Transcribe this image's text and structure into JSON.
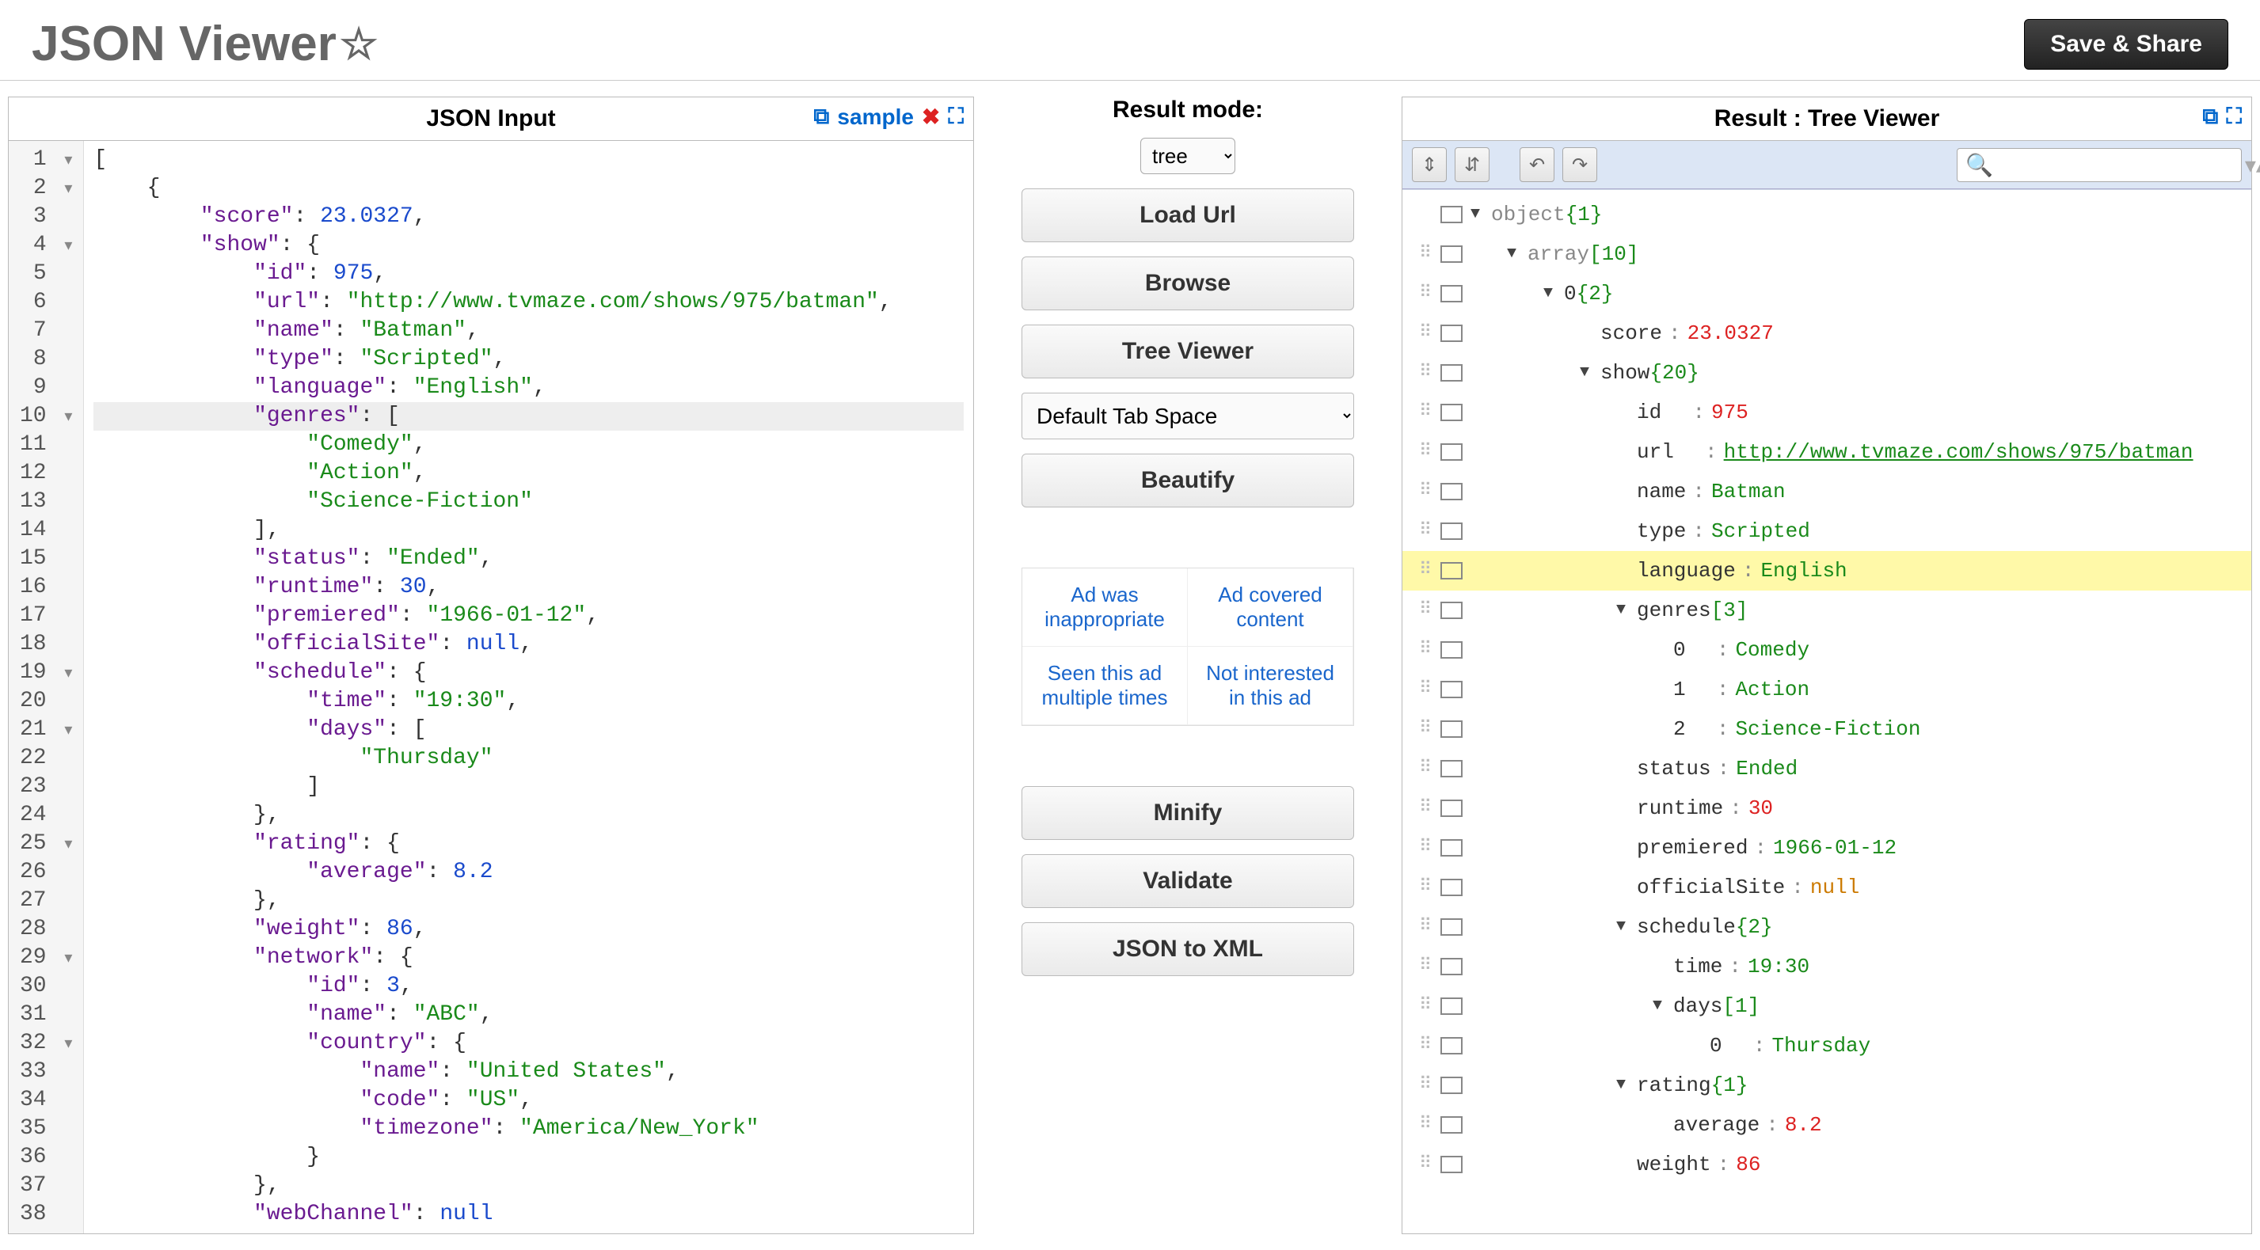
{
  "header": {
    "title": "JSON Viewer",
    "save_label": "Save & Share"
  },
  "left_panel": {
    "title": "JSON Input",
    "sample_label": "sample",
    "lines": [
      {
        "n": 1,
        "fold": "▾",
        "text": "[",
        "hl": false,
        "tokens": [
          [
            "[",
            "punc"
          ]
        ]
      },
      {
        "n": 2,
        "fold": "▾",
        "text": "    {",
        "hl": false,
        "tokens": [
          [
            "    {",
            "punc"
          ]
        ]
      },
      {
        "n": 3,
        "fold": "",
        "hl": false,
        "tokens": [
          [
            "        ",
            "punc"
          ],
          [
            "\"score\"",
            "key"
          ],
          [
            ": ",
            "punc"
          ],
          [
            "23.0327",
            "num"
          ],
          [
            ",",
            "punc"
          ]
        ]
      },
      {
        "n": 4,
        "fold": "▾",
        "hl": false,
        "tokens": [
          [
            "        ",
            "punc"
          ],
          [
            "\"show\"",
            "key"
          ],
          [
            ": {",
            "punc"
          ]
        ]
      },
      {
        "n": 5,
        "fold": "",
        "hl": false,
        "tokens": [
          [
            "            ",
            "punc"
          ],
          [
            "\"id\"",
            "key"
          ],
          [
            ": ",
            "punc"
          ],
          [
            "975",
            "num"
          ],
          [
            ",",
            "punc"
          ]
        ]
      },
      {
        "n": 6,
        "fold": "",
        "hl": false,
        "tokens": [
          [
            "            ",
            "punc"
          ],
          [
            "\"url\"",
            "key"
          ],
          [
            ": ",
            "punc"
          ],
          [
            "\"http://www.tvmaze.com/shows/975/batman\"",
            "str"
          ],
          [
            ",",
            "punc"
          ]
        ]
      },
      {
        "n": 7,
        "fold": "",
        "hl": false,
        "tokens": [
          [
            "            ",
            "punc"
          ],
          [
            "\"name\"",
            "key"
          ],
          [
            ": ",
            "punc"
          ],
          [
            "\"Batman\"",
            "str"
          ],
          [
            ",",
            "punc"
          ]
        ]
      },
      {
        "n": 8,
        "fold": "",
        "hl": false,
        "tokens": [
          [
            "            ",
            "punc"
          ],
          [
            "\"type\"",
            "key"
          ],
          [
            ": ",
            "punc"
          ],
          [
            "\"Scripted\"",
            "str"
          ],
          [
            ",",
            "punc"
          ]
        ]
      },
      {
        "n": 9,
        "fold": "",
        "hl": false,
        "tokens": [
          [
            "            ",
            "punc"
          ],
          [
            "\"language\"",
            "key"
          ],
          [
            ": ",
            "punc"
          ],
          [
            "\"English\"",
            "str"
          ],
          [
            ",",
            "punc"
          ]
        ]
      },
      {
        "n": 10,
        "fold": "▾",
        "hl": true,
        "tokens": [
          [
            "            ",
            "punc"
          ],
          [
            "\"genres\"",
            "key"
          ],
          [
            ": [",
            "punc"
          ]
        ]
      },
      {
        "n": 11,
        "fold": "",
        "hl": false,
        "tokens": [
          [
            "                ",
            "punc"
          ],
          [
            "\"Comedy\"",
            "str"
          ],
          [
            ",",
            "punc"
          ]
        ]
      },
      {
        "n": 12,
        "fold": "",
        "hl": false,
        "tokens": [
          [
            "                ",
            "punc"
          ],
          [
            "\"Action\"",
            "str"
          ],
          [
            ",",
            "punc"
          ]
        ]
      },
      {
        "n": 13,
        "fold": "",
        "hl": false,
        "tokens": [
          [
            "                ",
            "punc"
          ],
          [
            "\"Science-Fiction\"",
            "str"
          ]
        ]
      },
      {
        "n": 14,
        "fold": "",
        "hl": false,
        "tokens": [
          [
            "            ],",
            "punc"
          ]
        ]
      },
      {
        "n": 15,
        "fold": "",
        "hl": false,
        "tokens": [
          [
            "            ",
            "punc"
          ],
          [
            "\"status\"",
            "key"
          ],
          [
            ": ",
            "punc"
          ],
          [
            "\"Ended\"",
            "str"
          ],
          [
            ",",
            "punc"
          ]
        ]
      },
      {
        "n": 16,
        "fold": "",
        "hl": false,
        "tokens": [
          [
            "            ",
            "punc"
          ],
          [
            "\"runtime\"",
            "key"
          ],
          [
            ": ",
            "punc"
          ],
          [
            "30",
            "num"
          ],
          [
            ",",
            "punc"
          ]
        ]
      },
      {
        "n": 17,
        "fold": "",
        "hl": false,
        "tokens": [
          [
            "            ",
            "punc"
          ],
          [
            "\"premiered\"",
            "key"
          ],
          [
            ": ",
            "punc"
          ],
          [
            "\"1966-01-12\"",
            "str"
          ],
          [
            ",",
            "punc"
          ]
        ]
      },
      {
        "n": 18,
        "fold": "",
        "hl": false,
        "tokens": [
          [
            "            ",
            "punc"
          ],
          [
            "\"officialSite\"",
            "key"
          ],
          [
            ": ",
            "punc"
          ],
          [
            "null",
            "null"
          ],
          [
            ",",
            "punc"
          ]
        ]
      },
      {
        "n": 19,
        "fold": "▾",
        "hl": false,
        "tokens": [
          [
            "            ",
            "punc"
          ],
          [
            "\"schedule\"",
            "key"
          ],
          [
            ": {",
            "punc"
          ]
        ]
      },
      {
        "n": 20,
        "fold": "",
        "hl": false,
        "tokens": [
          [
            "                ",
            "punc"
          ],
          [
            "\"time\"",
            "key"
          ],
          [
            ": ",
            "punc"
          ],
          [
            "\"19:30\"",
            "str"
          ],
          [
            ",",
            "punc"
          ]
        ]
      },
      {
        "n": 21,
        "fold": "▾",
        "hl": false,
        "tokens": [
          [
            "                ",
            "punc"
          ],
          [
            "\"days\"",
            "key"
          ],
          [
            ": [",
            "punc"
          ]
        ]
      },
      {
        "n": 22,
        "fold": "",
        "hl": false,
        "tokens": [
          [
            "                    ",
            "punc"
          ],
          [
            "\"Thursday\"",
            "str"
          ]
        ]
      },
      {
        "n": 23,
        "fold": "",
        "hl": false,
        "tokens": [
          [
            "                ]",
            "punc"
          ]
        ]
      },
      {
        "n": 24,
        "fold": "",
        "hl": false,
        "tokens": [
          [
            "            },",
            "punc"
          ]
        ]
      },
      {
        "n": 25,
        "fold": "▾",
        "hl": false,
        "tokens": [
          [
            "            ",
            "punc"
          ],
          [
            "\"rating\"",
            "key"
          ],
          [
            ": {",
            "punc"
          ]
        ]
      },
      {
        "n": 26,
        "fold": "",
        "hl": false,
        "tokens": [
          [
            "                ",
            "punc"
          ],
          [
            "\"average\"",
            "key"
          ],
          [
            ": ",
            "punc"
          ],
          [
            "8.2",
            "num"
          ]
        ]
      },
      {
        "n": 27,
        "fold": "",
        "hl": false,
        "tokens": [
          [
            "            },",
            "punc"
          ]
        ]
      },
      {
        "n": 28,
        "fold": "",
        "hl": false,
        "tokens": [
          [
            "            ",
            "punc"
          ],
          [
            "\"weight\"",
            "key"
          ],
          [
            ": ",
            "punc"
          ],
          [
            "86",
            "num"
          ],
          [
            ",",
            "punc"
          ]
        ]
      },
      {
        "n": 29,
        "fold": "▾",
        "hl": false,
        "tokens": [
          [
            "            ",
            "punc"
          ],
          [
            "\"network\"",
            "key"
          ],
          [
            ": {",
            "punc"
          ]
        ]
      },
      {
        "n": 30,
        "fold": "",
        "hl": false,
        "tokens": [
          [
            "                ",
            "punc"
          ],
          [
            "\"id\"",
            "key"
          ],
          [
            ": ",
            "punc"
          ],
          [
            "3",
            "num"
          ],
          [
            ",",
            "punc"
          ]
        ]
      },
      {
        "n": 31,
        "fold": "",
        "hl": false,
        "tokens": [
          [
            "                ",
            "punc"
          ],
          [
            "\"name\"",
            "key"
          ],
          [
            ": ",
            "punc"
          ],
          [
            "\"ABC\"",
            "str"
          ],
          [
            ",",
            "punc"
          ]
        ]
      },
      {
        "n": 32,
        "fold": "▾",
        "hl": false,
        "tokens": [
          [
            "                ",
            "punc"
          ],
          [
            "\"country\"",
            "key"
          ],
          [
            ": {",
            "punc"
          ]
        ]
      },
      {
        "n": 33,
        "fold": "",
        "hl": false,
        "tokens": [
          [
            "                    ",
            "punc"
          ],
          [
            "\"name\"",
            "key"
          ],
          [
            ": ",
            "punc"
          ],
          [
            "\"United States\"",
            "str"
          ],
          [
            ",",
            "punc"
          ]
        ]
      },
      {
        "n": 34,
        "fold": "",
        "hl": false,
        "tokens": [
          [
            "                    ",
            "punc"
          ],
          [
            "\"code\"",
            "key"
          ],
          [
            ": ",
            "punc"
          ],
          [
            "\"US\"",
            "str"
          ],
          [
            ",",
            "punc"
          ]
        ]
      },
      {
        "n": 35,
        "fold": "",
        "hl": false,
        "tokens": [
          [
            "                    ",
            "punc"
          ],
          [
            "\"timezone\"",
            "key"
          ],
          [
            ": ",
            "punc"
          ],
          [
            "\"America/New_York\"",
            "str"
          ]
        ]
      },
      {
        "n": 36,
        "fold": "",
        "hl": false,
        "tokens": [
          [
            "                }",
            "punc"
          ]
        ]
      },
      {
        "n": 37,
        "fold": "",
        "hl": false,
        "tokens": [
          [
            "            },",
            "punc"
          ]
        ]
      },
      {
        "n": 38,
        "fold": "",
        "hl": false,
        "tokens": [
          [
            "            ",
            "punc"
          ],
          [
            "\"webChannel\"",
            "key"
          ],
          [
            ": ",
            "punc"
          ],
          [
            "null",
            "null"
          ]
        ]
      }
    ]
  },
  "middle": {
    "mode_title": "Result mode:",
    "mode_value": "tree",
    "buttons": {
      "load_url": "Load Url",
      "browse": "Browse",
      "tree_viewer": "Tree Viewer",
      "beautify": "Beautify",
      "minify": "Minify",
      "validate": "Validate",
      "json_to_xml": "JSON to XML"
    },
    "tab_space": "Default Tab Space",
    "ads": [
      "Ad was inappropriate",
      "Ad covered content",
      "Seen this ad multiple times",
      "Not interested in this ad"
    ]
  },
  "right_panel": {
    "title": "Result : Tree Viewer",
    "search_placeholder": "",
    "rows": [
      {
        "indent": 0,
        "drag": false,
        "box": true,
        "caret": "▼",
        "key": "object",
        "count": "{1}",
        "ktype": "type",
        "hl": false
      },
      {
        "indent": 1,
        "drag": true,
        "box": true,
        "caret": "▼",
        "key": "array",
        "count": "[10]",
        "ktype": "type",
        "hl": false
      },
      {
        "indent": 2,
        "drag": true,
        "box": true,
        "caret": "▼",
        "key": "0",
        "count": "{2}",
        "ktype": "key",
        "hl": false
      },
      {
        "indent": 3,
        "drag": true,
        "box": true,
        "caret": "",
        "key": "score",
        "val": "23.0327",
        "vtype": "num",
        "hl": false
      },
      {
        "indent": 3,
        "drag": true,
        "box": true,
        "caret": "▼",
        "key": "show",
        "count": "{20}",
        "ktype": "key",
        "hl": false
      },
      {
        "indent": 4,
        "drag": true,
        "box": true,
        "caret": "",
        "key": "id",
        "val": "975",
        "vtype": "num",
        "hl": false,
        "pad": true
      },
      {
        "indent": 4,
        "drag": true,
        "box": true,
        "caret": "",
        "key": "url",
        "val": "http://www.tvmaze.com/shows/975/batman",
        "vtype": "link",
        "hl": false,
        "pad": true
      },
      {
        "indent": 4,
        "drag": true,
        "box": true,
        "caret": "",
        "key": "name",
        "val": "Batman",
        "vtype": "str",
        "hl": false
      },
      {
        "indent": 4,
        "drag": true,
        "box": true,
        "caret": "",
        "key": "type",
        "val": "Scripted",
        "vtype": "str",
        "hl": false
      },
      {
        "indent": 4,
        "drag": true,
        "box": true,
        "caret": "",
        "key": "language",
        "val": "English",
        "vtype": "str",
        "hl": true
      },
      {
        "indent": 4,
        "drag": true,
        "box": true,
        "caret": "▼",
        "key": "genres",
        "count": "[3]",
        "ktype": "key",
        "hl": false
      },
      {
        "indent": 5,
        "drag": true,
        "box": true,
        "caret": "",
        "key": "0",
        "val": "Comedy",
        "vtype": "str",
        "hl": false,
        "pad": true
      },
      {
        "indent": 5,
        "drag": true,
        "box": true,
        "caret": "",
        "key": "1",
        "val": "Action",
        "vtype": "str",
        "hl": false,
        "pad": true
      },
      {
        "indent": 5,
        "drag": true,
        "box": true,
        "caret": "",
        "key": "2",
        "val": "Science-Fiction",
        "vtype": "str",
        "hl": false,
        "pad": true
      },
      {
        "indent": 4,
        "drag": true,
        "box": true,
        "caret": "",
        "key": "status",
        "val": "Ended",
        "vtype": "str",
        "hl": false
      },
      {
        "indent": 4,
        "drag": true,
        "box": true,
        "caret": "",
        "key": "runtime",
        "val": "30",
        "vtype": "num",
        "hl": false
      },
      {
        "indent": 4,
        "drag": true,
        "box": true,
        "caret": "",
        "key": "premiered",
        "val": "1966-01-12",
        "vtype": "str",
        "hl": false
      },
      {
        "indent": 4,
        "drag": true,
        "box": true,
        "caret": "",
        "key": "officialSite",
        "val": "null",
        "vtype": "null",
        "hl": false
      },
      {
        "indent": 4,
        "drag": true,
        "box": true,
        "caret": "▼",
        "key": "schedule",
        "count": "{2}",
        "ktype": "key",
        "hl": false
      },
      {
        "indent": 5,
        "drag": true,
        "box": true,
        "caret": "",
        "key": "time",
        "val": "19:30",
        "vtype": "str",
        "hl": false
      },
      {
        "indent": 5,
        "drag": true,
        "box": true,
        "caret": "▼",
        "key": "days",
        "count": "[1]",
        "ktype": "key",
        "hl": false
      },
      {
        "indent": 6,
        "drag": true,
        "box": true,
        "caret": "",
        "key": "0",
        "val": "Thursday",
        "vtype": "str",
        "hl": false,
        "pad": true
      },
      {
        "indent": 4,
        "drag": true,
        "box": true,
        "caret": "▼",
        "key": "rating",
        "count": "{1}",
        "ktype": "key",
        "hl": false
      },
      {
        "indent": 5,
        "drag": true,
        "box": true,
        "caret": "",
        "key": "average",
        "val": "8.2",
        "vtype": "num",
        "hl": false
      },
      {
        "indent": 4,
        "drag": true,
        "box": true,
        "caret": "",
        "key": "weight",
        "val": "86",
        "vtype": "num",
        "hl": false
      }
    ]
  }
}
